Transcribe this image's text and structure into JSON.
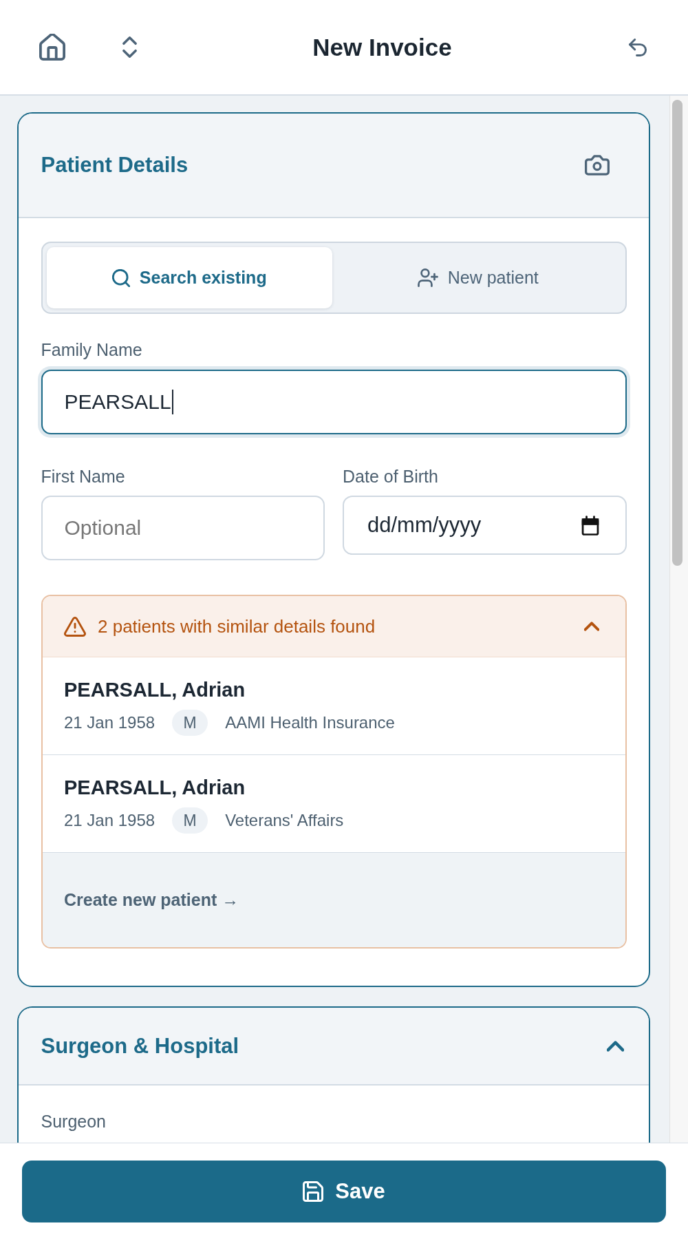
{
  "header": {
    "title": "New Invoice"
  },
  "patient_details": {
    "title": "Patient Details",
    "mode_tabs": [
      {
        "kind": "search",
        "label": "Search existing",
        "selected": true
      },
      {
        "kind": "create",
        "label": "New patient",
        "selected": false
      }
    ],
    "family_name": {
      "label": "Family Name",
      "value": "PEARSALL",
      "focused": true
    },
    "first_name": {
      "label": "First Name",
      "placeholder": "Optional",
      "focused": false
    },
    "date_of_birth": {
      "label": "Date of Birth",
      "placeholder": "dd/mm/yyyy",
      "focused": false
    },
    "matches": {
      "message": "2 patients with similar details found",
      "expanded": true,
      "patients": [
        {
          "name": "PEARSALL, Adrian",
          "dob": "21 Jan 1958",
          "sex": "M",
          "insurer": "AAMI Health Insurance"
        },
        {
          "name": "PEARSALL, Adrian",
          "dob": "21 Jan 1958",
          "sex": "M",
          "insurer": "Veterans' Affairs"
        }
      ],
      "create_link": "Create new patient →"
    }
  },
  "surgeon_hospital": {
    "title": "Surgeon & Hospital",
    "expanded": true,
    "fields": [
      {
        "label": "Surgeon"
      }
    ]
  },
  "footer": {
    "save_label": "Save"
  }
}
